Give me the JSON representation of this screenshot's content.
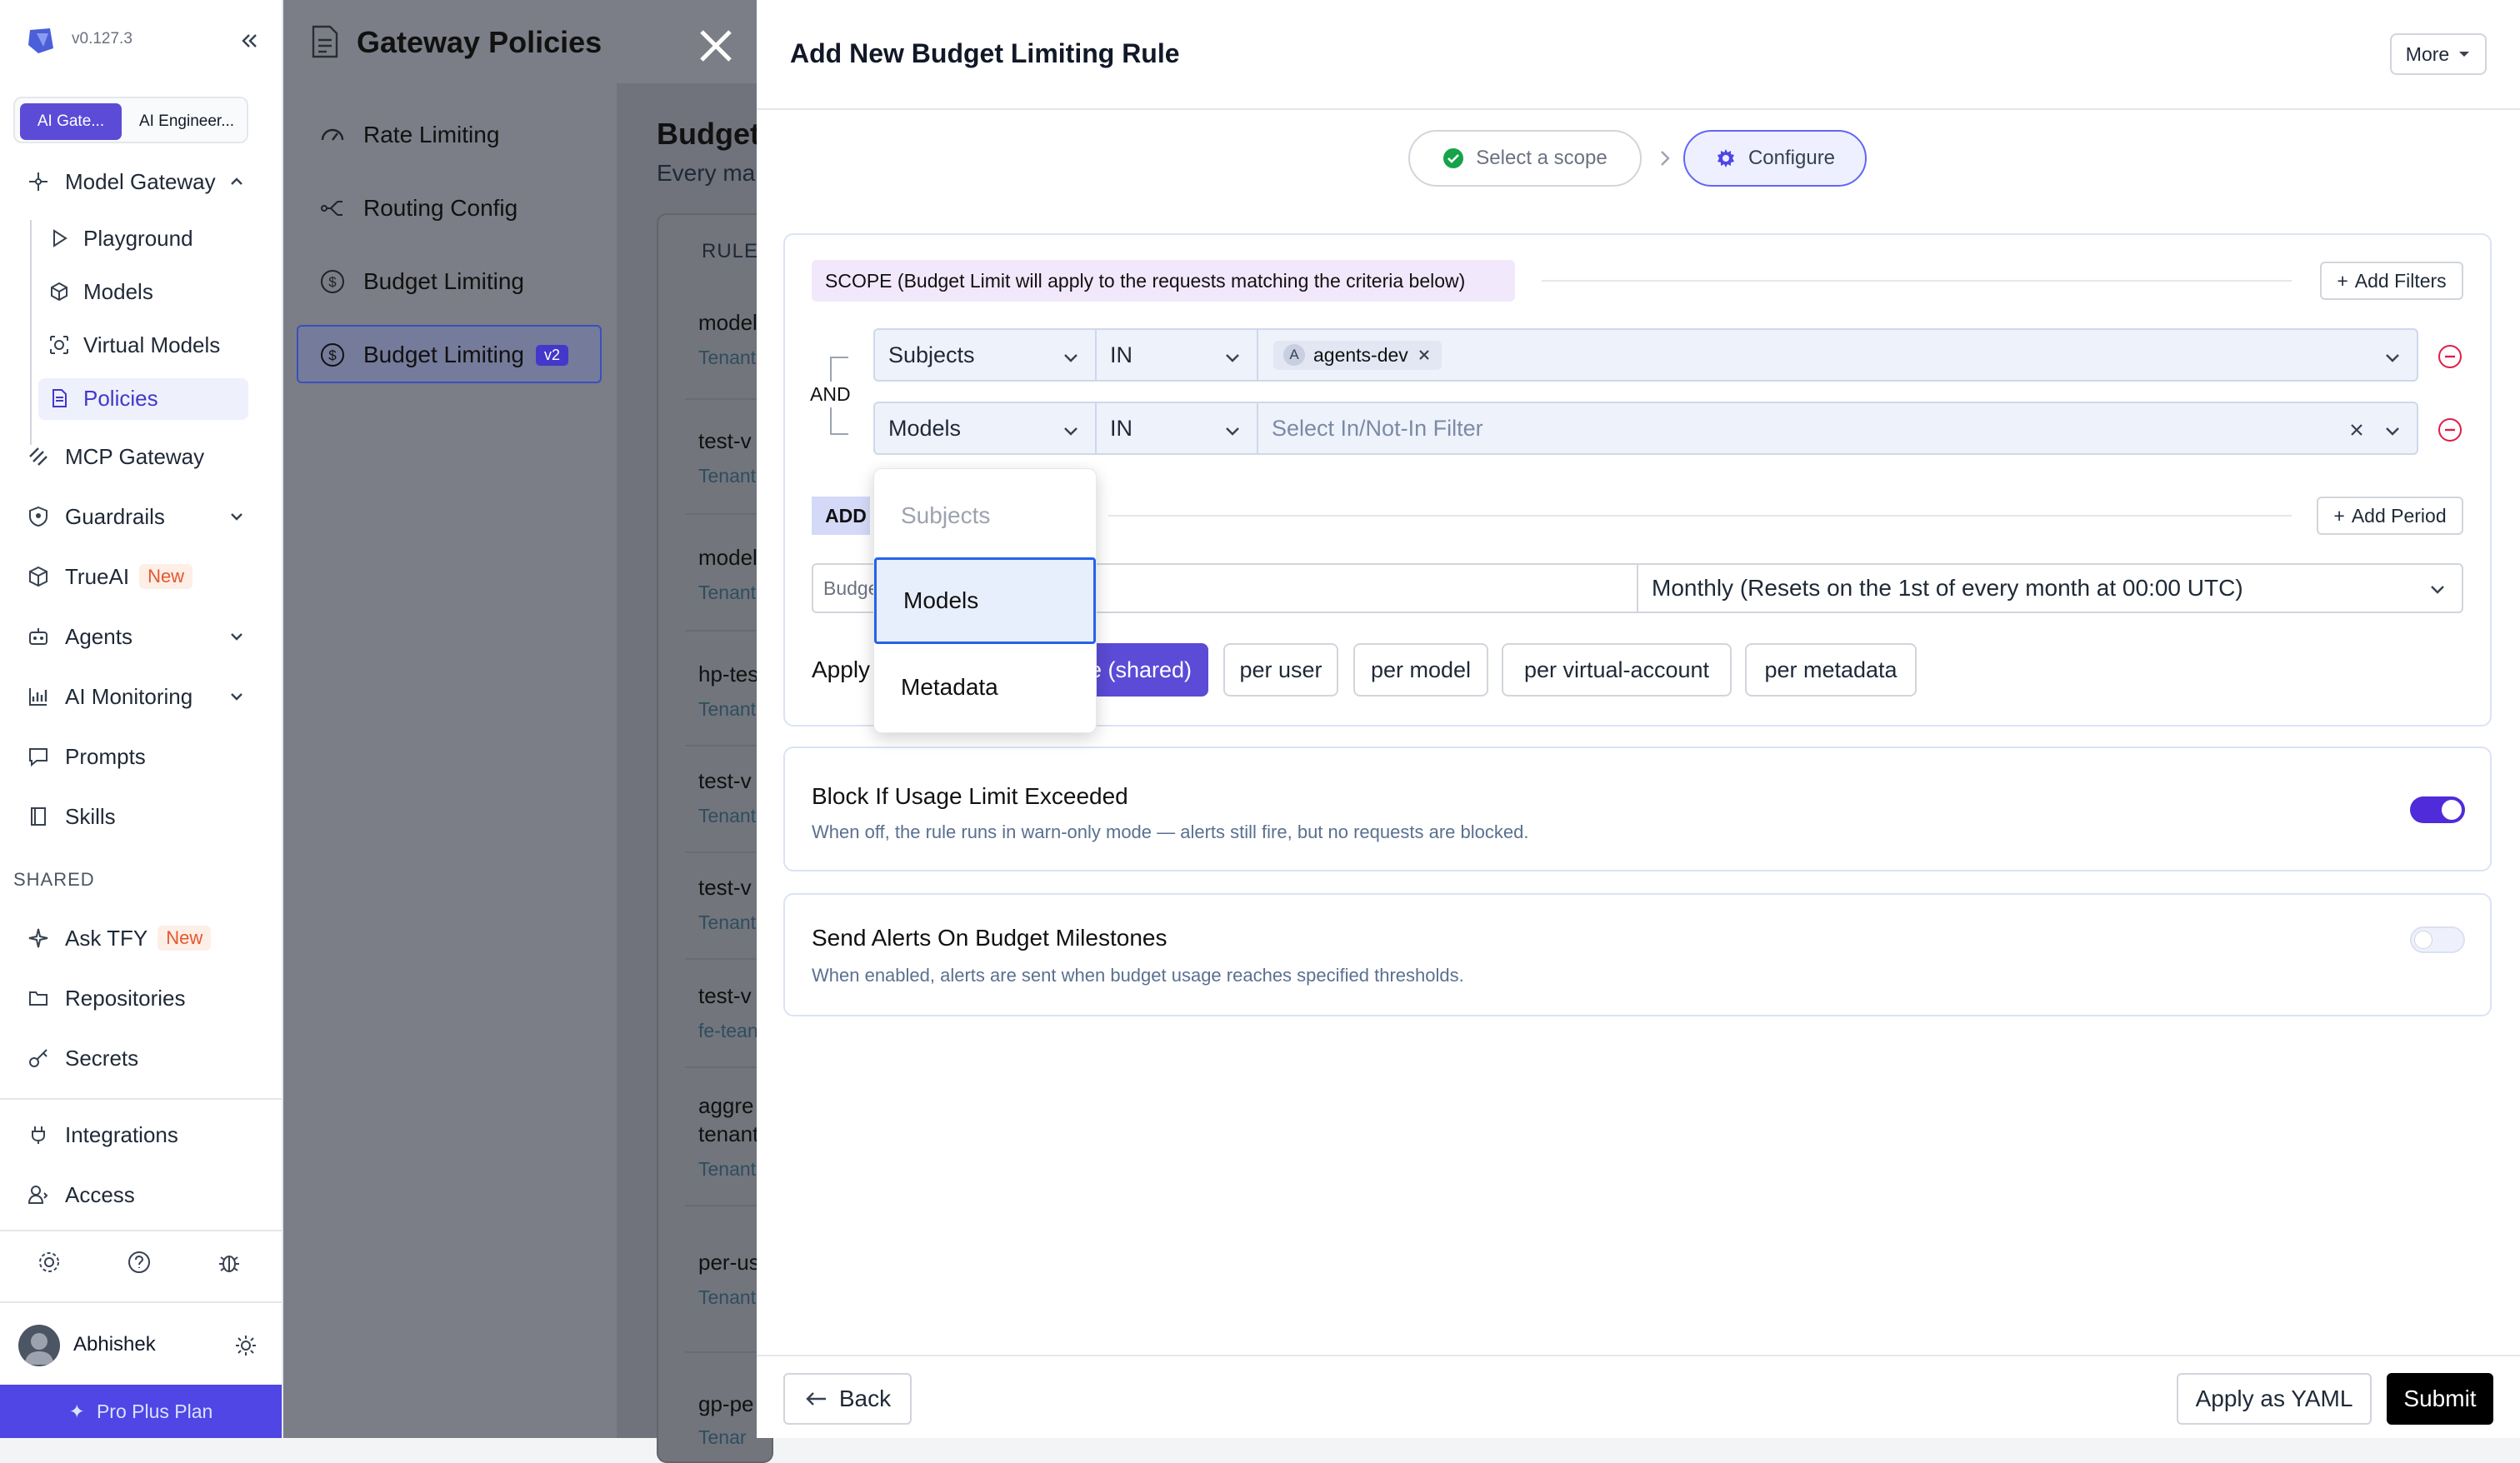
{
  "sidebar": {
    "version": "v0.127.3",
    "workspace_tabs": [
      "AI Gate...",
      "AI Engineer..."
    ],
    "model_gateway": {
      "label": "Model Gateway",
      "items": [
        "Playground",
        "Models",
        "Virtual Models",
        "Policies"
      ]
    },
    "items": [
      {
        "label": "MCP Gateway",
        "icon": "mcp-icon"
      },
      {
        "label": "Guardrails",
        "icon": "shield-icon"
      },
      {
        "label": "TrueAI",
        "icon": "cube-icon",
        "badge": "New"
      },
      {
        "label": "Agents",
        "icon": "robot-icon"
      },
      {
        "label": "AI Monitoring",
        "icon": "chart-icon"
      },
      {
        "label": "Prompts",
        "icon": "chat-icon"
      },
      {
        "label": "Skills",
        "icon": "book-icon"
      }
    ],
    "shared_label": "SHARED",
    "shared_items": [
      {
        "label": "Ask TFY",
        "icon": "sparkle-icon",
        "badge": "New"
      },
      {
        "label": "Repositories",
        "icon": "folder-icon"
      },
      {
        "label": "Secrets",
        "icon": "key-icon"
      }
    ],
    "bottom_items": [
      {
        "label": "Integrations",
        "icon": "plug-icon"
      },
      {
        "label": "Access",
        "icon": "users-icon"
      }
    ],
    "user_name": "Abhishek",
    "plan": "Pro Plus Plan"
  },
  "gateway": {
    "title": "Gateway Policies",
    "nav": [
      "Rate Limiting",
      "Routing Config",
      "Budget Limiting",
      "Budget Limiting"
    ],
    "active_badge": "v2"
  },
  "list": {
    "title": "Budget",
    "subtitle": "Every ma",
    "header": "RULE",
    "rows": [
      {
        "t": "model",
        "s": "Tenant"
      },
      {
        "t": "test-v",
        "s": "Tenant"
      },
      {
        "t": "model",
        "s": "Tenant"
      },
      {
        "t": "hp-tes",
        "s": "Tenant"
      },
      {
        "t": "test-v",
        "s": "Tenant"
      },
      {
        "t": "test-v",
        "s": "Tenant"
      },
      {
        "t": "test-v",
        "s": "fe-tean"
      },
      {
        "t": "aggre",
        "t2": "tenant",
        "s": "Tenant"
      },
      {
        "t": "per-us",
        "s": "Tenant"
      },
      {
        "t": "gp-pe",
        "s": "Tenar"
      }
    ]
  },
  "panel": {
    "title": "Add New Budget Limiting Rule",
    "more": "More",
    "steps": [
      "Select a scope",
      "Configure"
    ],
    "scope_label": "SCOPE (Budget Limit will apply to the requests matching the criteria below)",
    "add_filters": "Add Filters",
    "and_label": "AND",
    "filters": [
      {
        "field": "Subjects",
        "op": "IN",
        "chip_avatar": "A",
        "chip": "agents-dev"
      },
      {
        "field": "Models",
        "op": "IN",
        "placeholder": "Select In/Not-In Filter"
      }
    ],
    "dropdown_options": [
      "Subjects",
      "Models",
      "Metadata"
    ],
    "add_label": "ADD",
    "add_period": "Add Period",
    "budget_placeholder": "Budge",
    "period_value": "Monthly (Resets on the 1st of every month at 00:00 UTC)",
    "apply_label": "Apply",
    "apply_options": [
      "e (shared)",
      "per user",
      "per model",
      "per virtual-account",
      "per metadata"
    ],
    "block_title": "Block If Usage Limit Exceeded",
    "block_desc": "When off, the rule runs in warn-only mode — alerts still fire, but no requests are blocked.",
    "block_enabled": true,
    "alerts_title": "Send Alerts On Budget Milestones",
    "alerts_desc": "When enabled, alerts are sent when budget usage reaches specified thresholds.",
    "alerts_enabled": false,
    "back": "Back",
    "apply_yaml": "Apply as YAML",
    "submit": "Submit"
  },
  "colors": {
    "accent": "#5b4bd6",
    "active_border": "#2563eb"
  }
}
